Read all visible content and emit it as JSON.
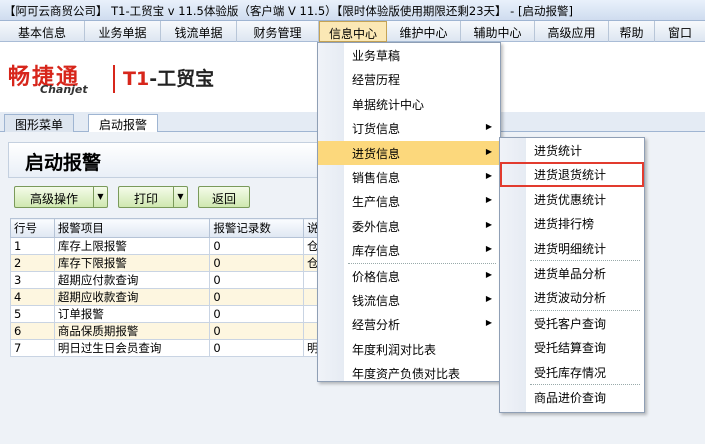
{
  "window": {
    "title": "【阿可云商贸公司】 T1-工贸宝 v 11.5体验版（客户端 V 11.5）【限时体验版使用期限还剩23天】 - [启动报警]"
  },
  "menubar": [
    {
      "label": "基本信息"
    },
    {
      "label": "业务单据"
    },
    {
      "label": "钱流单据"
    },
    {
      "label": "财务管理"
    },
    {
      "label": "信息中心"
    },
    {
      "label": "维护中心"
    },
    {
      "label": "辅助中心"
    },
    {
      "label": "高级应用"
    },
    {
      "label": "帮助"
    },
    {
      "label": "窗口"
    }
  ],
  "logo": {
    "brand_cn": "畅捷通",
    "brand_en": "Chanjet",
    "product_prefix": "T1",
    "product_name": "-工贸宝"
  },
  "tabs": [
    {
      "label": "图形菜单"
    },
    {
      "label": "启动报警"
    }
  ],
  "panel": {
    "title": "启动报警",
    "buttons": {
      "advanced": "高级操作",
      "print": "打印",
      "back": "返回"
    }
  },
  "table": {
    "headers": [
      "行号",
      "报警项目",
      "报警记录数",
      "说"
    ],
    "rows": [
      {
        "no": "1",
        "item": "库存上限报警",
        "count": "0",
        "extra": "仓"
      },
      {
        "no": "2",
        "item": "库存下限报警",
        "count": "0",
        "extra": "仓"
      },
      {
        "no": "3",
        "item": "超期应付款查询",
        "count": "0",
        "extra": ""
      },
      {
        "no": "4",
        "item": "超期应收款查询",
        "count": "0",
        "extra": ""
      },
      {
        "no": "5",
        "item": "订单报警",
        "count": "0",
        "extra": ""
      },
      {
        "no": "6",
        "item": "商品保质期报警",
        "count": "0",
        "extra": ""
      },
      {
        "no": "7",
        "item": "明日过生日会员查询",
        "count": "0",
        "extra": "明"
      }
    ]
  },
  "info_menu": [
    {
      "label": "业务草稿",
      "sub": false
    },
    {
      "label": "经营历程",
      "sub": false
    },
    {
      "label": "单据统计中心",
      "sub": false
    },
    {
      "label": "订货信息",
      "sub": true
    },
    {
      "label": "进货信息",
      "sub": true
    },
    {
      "label": "销售信息",
      "sub": true
    },
    {
      "label": "生产信息",
      "sub": true
    },
    {
      "label": "委外信息",
      "sub": true
    },
    {
      "label": "库存信息",
      "sub": true
    },
    {
      "label": "价格信息",
      "sub": true
    },
    {
      "label": "钱流信息",
      "sub": true
    },
    {
      "label": "经营分析",
      "sub": true
    },
    {
      "label": "年度利润对比表",
      "sub": false
    },
    {
      "label": "年度资产负债对比表",
      "sub": false
    }
  ],
  "purchase_menu": [
    {
      "label": "进货统计"
    },
    {
      "label": "进货退货统计"
    },
    {
      "label": "进货优惠统计"
    },
    {
      "label": "进货排行榜"
    },
    {
      "label": "进货明细统计"
    },
    {
      "label": "进货单品分析"
    },
    {
      "label": "进货波动分析"
    },
    {
      "label": "受托客户查询"
    },
    {
      "label": "受托结算查询"
    },
    {
      "label": "受托库存情况"
    },
    {
      "label": "商品进价查询"
    }
  ],
  "submenu_arrow": "▶",
  "dropdown_arrow": "▼",
  "colors": {
    "highlight": "#fcd87c",
    "focus_box": "#e23b2e",
    "brand_red": "#d7261b"
  }
}
